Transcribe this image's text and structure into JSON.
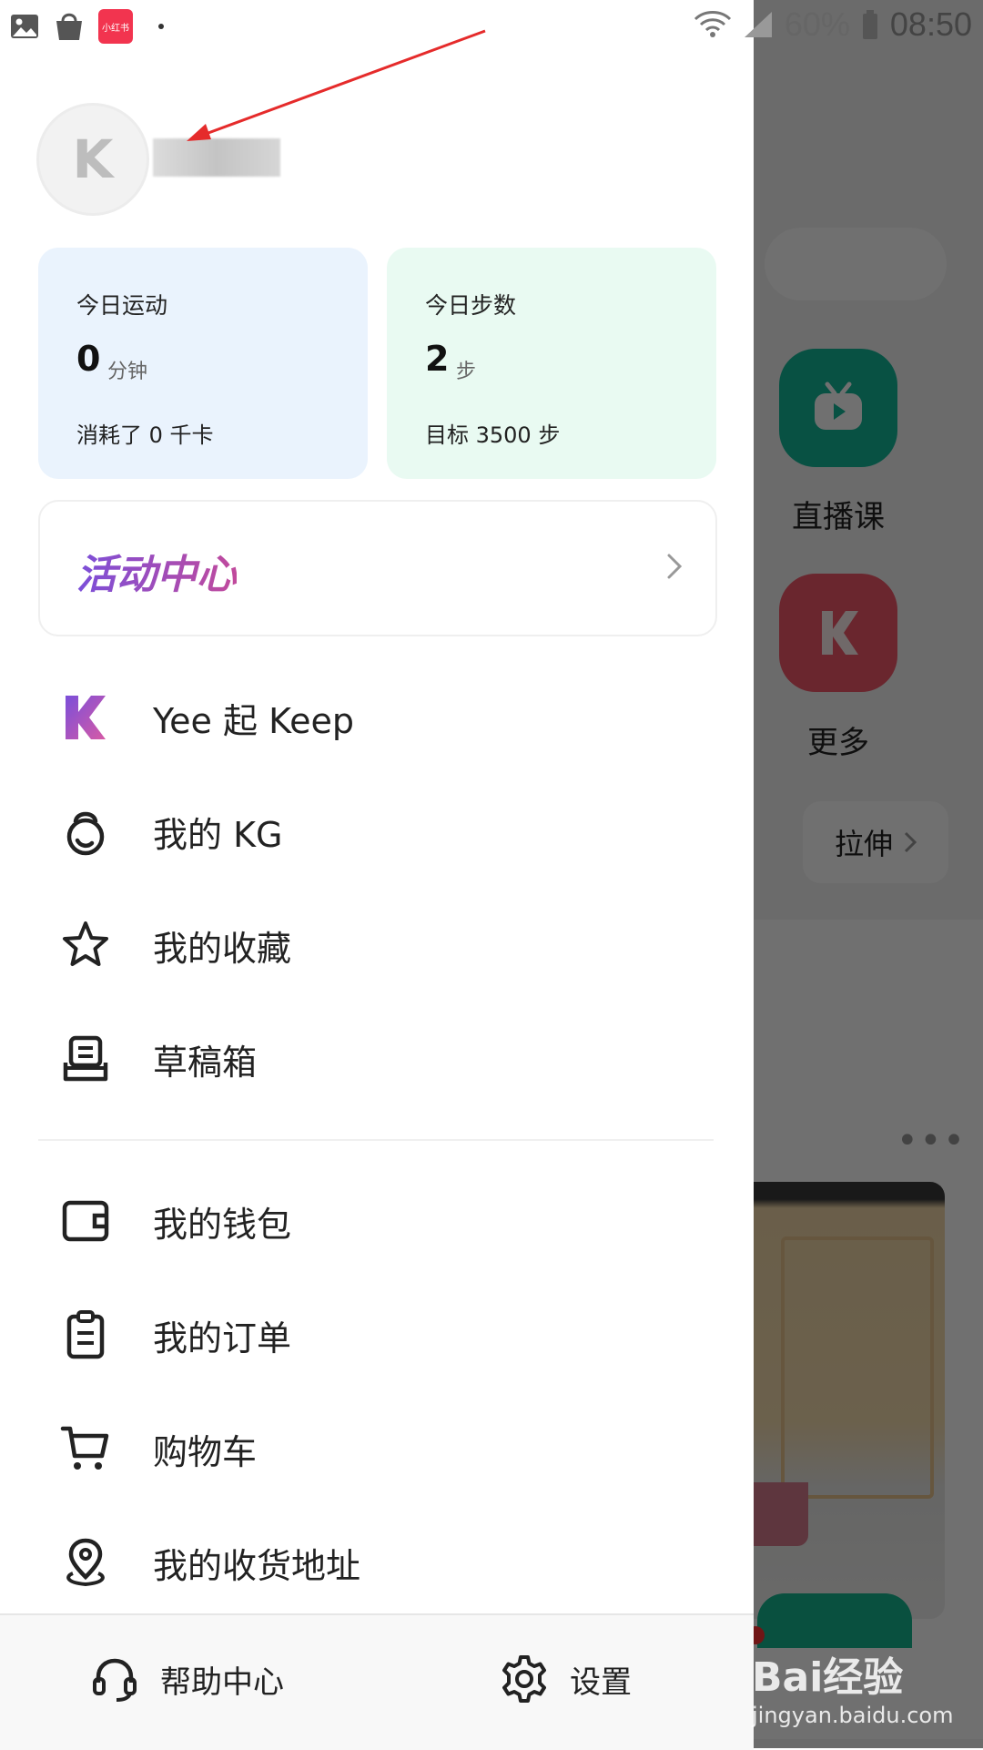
{
  "status_bar": {
    "battery": "60%",
    "time": "08:50",
    "app_badge": "小红书"
  },
  "profile": {
    "avatar_letter": "K"
  },
  "stats": {
    "exercise": {
      "title": "今日运动",
      "value": "0",
      "unit": "分钟",
      "sub": "消耗了 0 千卡",
      "bg": "#eaf3fd"
    },
    "steps": {
      "title": "今日步数",
      "value": "2",
      "unit": "步",
      "sub": "目标 3500 步",
      "bg": "#e9faf2"
    }
  },
  "activity_center": {
    "label": "活动中心"
  },
  "menu": {
    "group1": [
      {
        "label": "Yee 起 Keep",
        "icon": "keep-logo-icon"
      },
      {
        "label": "我的 KG",
        "icon": "kettlebell-icon"
      },
      {
        "label": "我的收藏",
        "icon": "star-icon"
      },
      {
        "label": "草稿箱",
        "icon": "drafts-icon"
      }
    ],
    "group2": [
      {
        "label": "我的钱包",
        "icon": "wallet-icon"
      },
      {
        "label": "我的订单",
        "icon": "clipboard-icon"
      },
      {
        "label": "购物车",
        "icon": "cart-icon"
      },
      {
        "label": "我的收货地址",
        "icon": "location-pin-icon"
      }
    ]
  },
  "bottom_bar": {
    "help": "帮助中心",
    "settings": "设置"
  },
  "background_app": {
    "live_class": "直播课",
    "more": "更多",
    "stretch": "拉伸"
  },
  "watermark": {
    "brand": "Bai经验",
    "url": "jingyan.baidu.com"
  },
  "colors": {
    "accent_purple": "#7b4fd9",
    "arrow_red": "#e52b2b",
    "teal": "#14b89a",
    "red_tile": "#f2586a"
  }
}
